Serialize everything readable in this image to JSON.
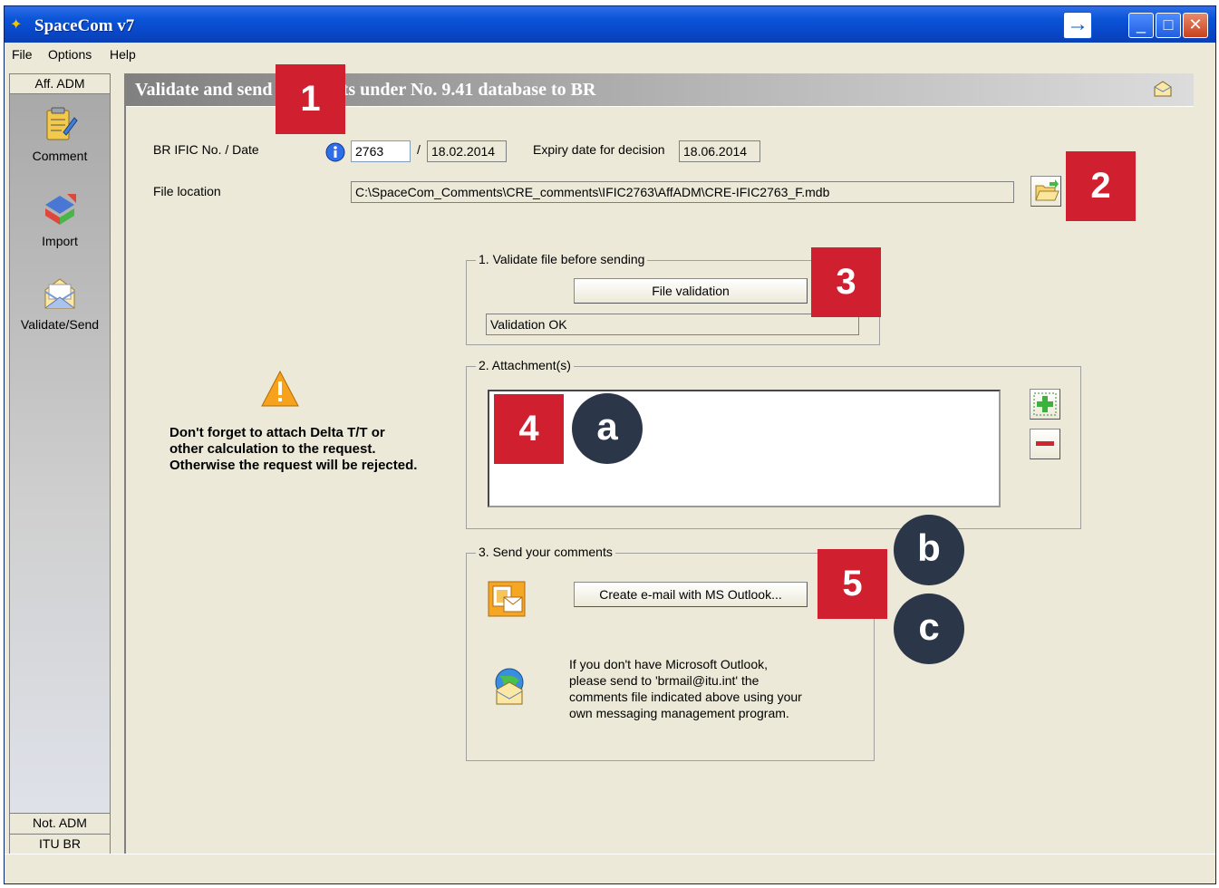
{
  "window": {
    "title": "SpaceCom v7"
  },
  "menu": {
    "items": [
      "File",
      "Options",
      "Help"
    ]
  },
  "sidebar": {
    "header": "Aff. ADM",
    "items": [
      {
        "label": "Comment",
        "icon": "comment-icon"
      },
      {
        "label": "Import",
        "icon": "import-icon"
      },
      {
        "label": "Validate/Send",
        "icon": "validate-send-icon"
      }
    ],
    "footer": [
      "Not. ADM",
      "ITU BR"
    ]
  },
  "header": {
    "title": "Validate and send comments under No. 9.41 database to BR"
  },
  "form": {
    "ific_label": "BR IFIC No. / Date",
    "ific_no": "2763",
    "date_separator": "/",
    "ific_date": "18.02.2014",
    "expiry_label": "Expiry date for decision",
    "expiry_date": "18.06.2014",
    "file_location_label": "File location",
    "file_location": "C:\\SpaceCom_Comments\\CRE_comments\\IFIC2763\\AffADM\\CRE-IFIC2763_F.mdb"
  },
  "validate": {
    "group_title": "1. Validate file before sending",
    "button_label": "File validation",
    "result": "Validation OK"
  },
  "attachments": {
    "group_title": "2. Attachment(s)"
  },
  "warning": {
    "lines": [
      "Don't forget to attach Delta T/T or",
      "other calculation to the request.",
      "Otherwise the request will be rejected."
    ]
  },
  "send": {
    "group_title": "3. Send your comments",
    "outlook_button": "Create e-mail with MS Outlook...",
    "note_lines": [
      "If you don't have Microsoft Outlook,",
      "please send to 'brmail@itu.int' the",
      "comments file indicated above using your",
      "own messaging management program."
    ]
  },
  "callouts": {
    "numbers": [
      "1",
      "2",
      "3",
      "4",
      "5"
    ],
    "letters": [
      "a",
      "b",
      "c"
    ]
  },
  "colors": {
    "callout_red": "#d01f2e",
    "callout_dark": "#2b3648",
    "title_blue": "#0a54d8"
  }
}
